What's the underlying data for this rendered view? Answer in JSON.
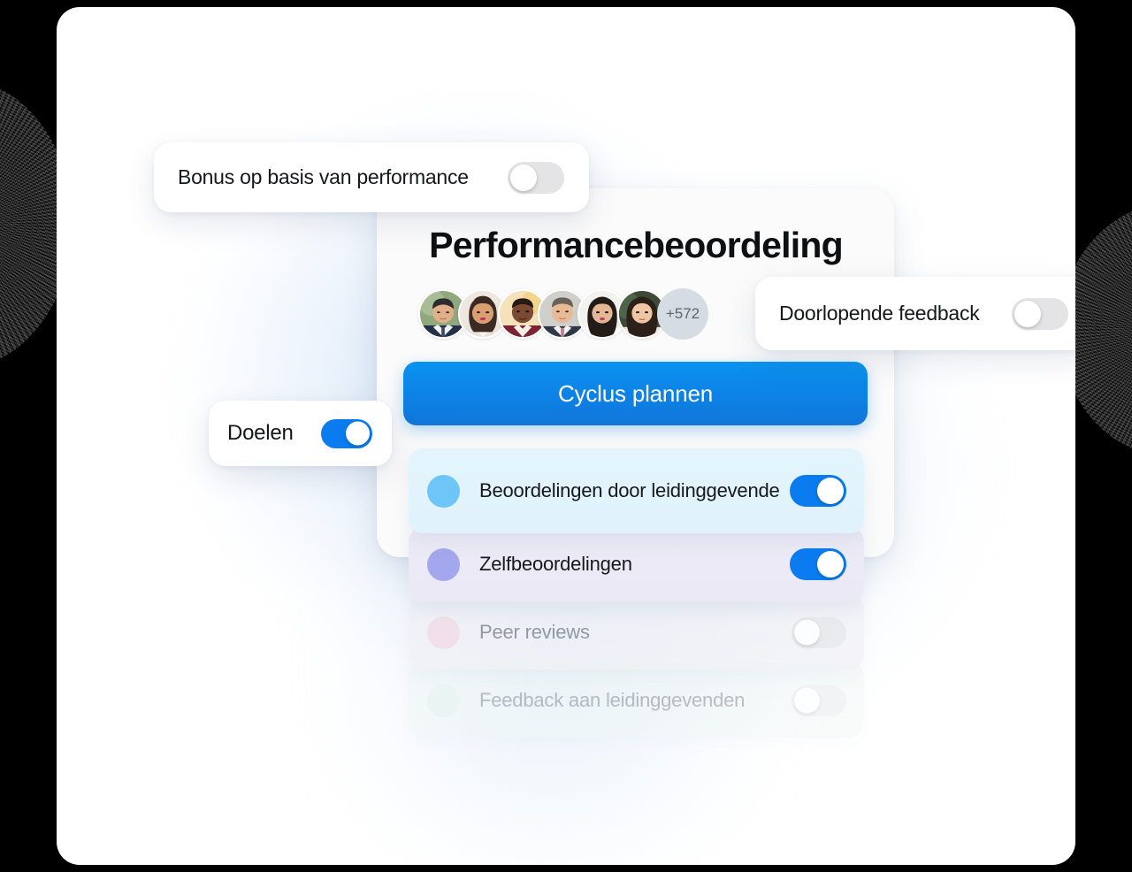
{
  "page": {
    "title": "Performancebeoordeling",
    "background_color": "#ffffff",
    "accent_color": "#0a7cf0"
  },
  "avatars": {
    "count_label": "+572",
    "people": [
      {
        "name": "avatar-person-1"
      },
      {
        "name": "avatar-person-2"
      },
      {
        "name": "avatar-person-3"
      },
      {
        "name": "avatar-person-4"
      },
      {
        "name": "avatar-person-5"
      },
      {
        "name": "avatar-person-6"
      }
    ]
  },
  "cta": {
    "label": "Cyclus plannen"
  },
  "options": [
    {
      "label": "Beoordelingen door leidinggevende",
      "dot_color": "#6dc6f7",
      "toggle_state": "on",
      "row_color": "#e3f4fc"
    },
    {
      "label": "Zelfbeoordelingen",
      "dot_color": "#a3a7ed",
      "toggle_state": "on",
      "row_color": "#eceaf6"
    },
    {
      "label": "Peer reviews",
      "dot_color": "#f2d4de",
      "toggle_state": "off",
      "row_color": "#efeff4"
    },
    {
      "label": "Feedback aan leidinggevenden",
      "dot_color": "#dbf0e5",
      "toggle_state": "off",
      "row_color": "#eef5f2"
    }
  ],
  "floating_cards": [
    {
      "label": "Bonus op basis van performance",
      "toggle_state": "off"
    },
    {
      "label": "Doorlopende feedback",
      "toggle_state": "off"
    },
    {
      "label": "Doelen",
      "toggle_state": "on"
    }
  ]
}
